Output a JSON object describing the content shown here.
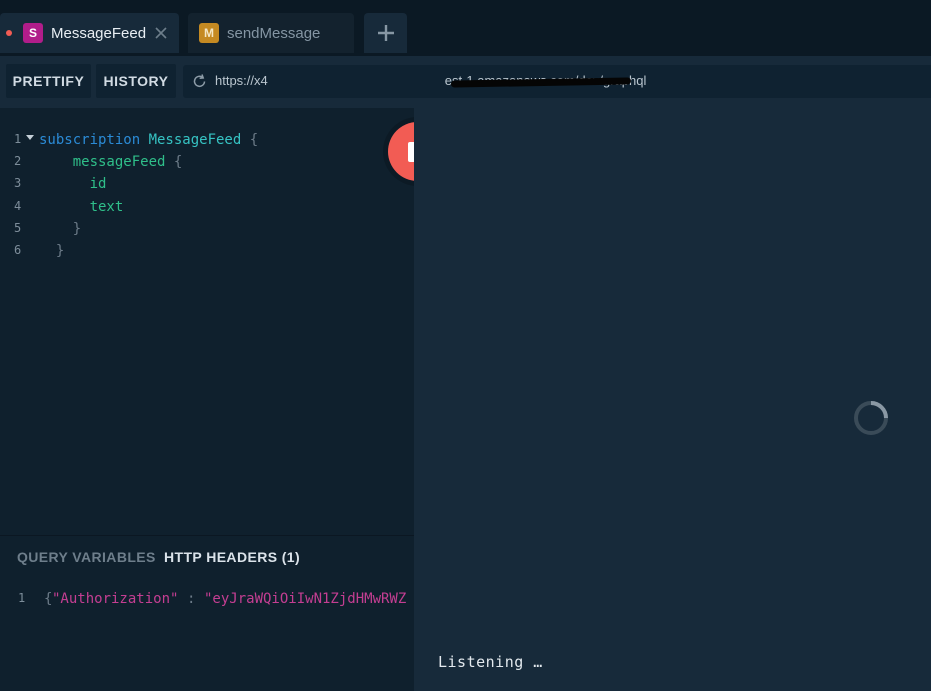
{
  "tabs": [
    {
      "badge": "S",
      "title": "MessageFeed",
      "active": true
    },
    {
      "badge": "M",
      "title": "sendMessage",
      "active": false
    }
  ],
  "toolbar": {
    "prettify_label": "PRETTIFY",
    "history_label": "HISTORY",
    "url": "https://x4                                                 est-1.amazonaws.com/dev/graphql"
  },
  "editor": {
    "lines": [
      {
        "n": "1",
        "tokens": [
          {
            "t": "subscription",
            "c": "kw"
          },
          {
            "t": " "
          },
          {
            "t": "MessageFeed",
            "c": "def"
          },
          {
            "t": " {",
            "c": "pun"
          }
        ]
      },
      {
        "n": "2",
        "tokens": [
          {
            "t": "  "
          },
          {
            "t": "messageFeed",
            "c": "fld"
          },
          {
            "t": " {",
            "c": "pun"
          }
        ]
      },
      {
        "n": "3",
        "tokens": [
          {
            "t": "    "
          },
          {
            "t": "id",
            "c": "fld"
          }
        ]
      },
      {
        "n": "4",
        "tokens": [
          {
            "t": "    "
          },
          {
            "t": "text",
            "c": "fld"
          }
        ]
      },
      {
        "n": "5",
        "tokens": [
          {
            "t": "  "
          },
          {
            "t": "}",
            "c": "pun"
          }
        ]
      },
      {
        "n": "6",
        "tokens": [
          {
            "t": "}",
            "c": "pun"
          }
        ]
      }
    ]
  },
  "variables": {
    "query_variables_label": "QUERY VARIABLES",
    "http_headers_label": "HTTP HEADERS (1)",
    "line_number": "1",
    "open_brace": "{",
    "header_key": "\"Authorization\"",
    "colon": ": ",
    "header_value": "\"eyJraWQiOiIwN1ZjdHMwRWZ"
  },
  "result": {
    "status_text": "Listening …"
  },
  "colors": {
    "accent_red": "#f25c54",
    "subscription_badge": "#b11d8a",
    "mutation_badge": "#c58a22"
  }
}
